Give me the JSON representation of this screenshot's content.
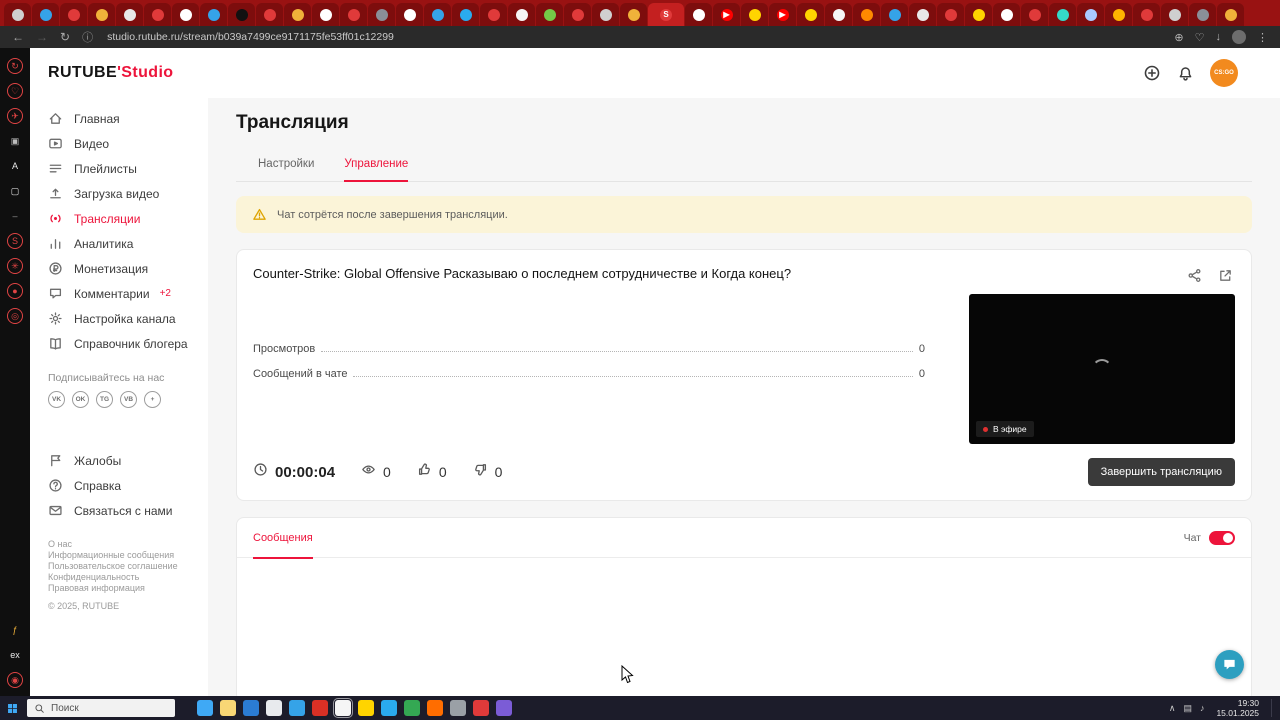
{
  "browser": {
    "url": "studio.rutube.ru/stream/b039a7499ce9171175fe53ff01c12299",
    "nav": {
      "back": "←",
      "forward": "→",
      "reload": "↻",
      "info": "ⓘ",
      "menu": "⋮"
    },
    "actions": [
      {
        "name": "extensions",
        "g": "⊕"
      },
      {
        "name": "favorites",
        "g": "♡"
      },
      {
        "name": "downloads",
        "g": "↓"
      }
    ],
    "tabs": [
      {
        "c": "#cfcfcf"
      },
      {
        "c": "#35a3e8"
      },
      {
        "c": "#e03a3a"
      },
      {
        "c": "#f0b23a"
      },
      {
        "c": "#e8e8e8"
      },
      {
        "c": "#e03a3a"
      },
      {
        "c": "#ffffff"
      },
      {
        "c": "#35a3e8"
      },
      {
        "c": "#111111"
      },
      {
        "c": "#e03a3a"
      },
      {
        "c": "#f0b23a"
      },
      {
        "c": "#ffffff"
      },
      {
        "c": "#e03a3a"
      },
      {
        "c": "#8a8f98"
      },
      {
        "c": "#ffffff"
      },
      {
        "c": "#35a3e8"
      },
      {
        "c": "#2aabee"
      },
      {
        "c": "#e03a3a"
      },
      {
        "c": "#f5f5f5"
      },
      {
        "c": "#74c947"
      },
      {
        "c": "#e03a3a"
      },
      {
        "c": "#d0d0d0"
      },
      {
        "c": "#f0b23a"
      },
      {
        "c": "#e03a3a",
        "g": "S",
        "active": true
      },
      {
        "c": "#ffffff"
      },
      {
        "c": "#ff0000",
        "g": "▶"
      },
      {
        "c": "#ffd400"
      },
      {
        "c": "#ff0000",
        "g": "▶"
      },
      {
        "c": "#ffd400"
      },
      {
        "c": "#f5f5f5"
      },
      {
        "c": "#ff8a00"
      },
      {
        "c": "#35a3e8"
      },
      {
        "c": "#e8e8e8"
      },
      {
        "c": "#e03a3a"
      },
      {
        "c": "#ffd400"
      },
      {
        "c": "#ffffff"
      },
      {
        "c": "#e03a3a"
      },
      {
        "c": "#35d8c8"
      },
      {
        "c": "#a9c9ff"
      },
      {
        "c": "#ffb300"
      },
      {
        "c": "#e03a3a"
      },
      {
        "c": "#cfcfcf"
      },
      {
        "c": "#8a8f98"
      },
      {
        "c": "#f0b23a"
      }
    ]
  },
  "left_rail": {
    "top": [
      {
        "g": "↻",
        "c": "#e04444",
        "b": true
      },
      {
        "g": "♡",
        "c": "#e04444",
        "b": true
      },
      {
        "g": "✈",
        "c": "#e04444",
        "b": true
      },
      {
        "g": "▣",
        "c": "#bdbdbd",
        "b": false
      },
      {
        "g": "A",
        "c": "#e8e8e8",
        "b": false
      },
      {
        "g": "▢",
        "c": "#e8e8e8",
        "b": false
      },
      {
        "g": "–",
        "c": "#9a9a9a",
        "b": false
      },
      {
        "g": "S",
        "c": "#e04444",
        "b": true
      },
      {
        "g": "✳",
        "c": "#e04444",
        "b": true
      },
      {
        "g": "●",
        "c": "#e04444",
        "b": true
      },
      {
        "g": "◎",
        "c": "#e04444",
        "b": true
      }
    ],
    "bottom": [
      {
        "g": "ƒ",
        "c": "#f0b23a",
        "b": false
      },
      {
        "g": "ex",
        "c": "#e8e8e8",
        "b": false
      },
      {
        "g": "◉",
        "c": "#e04444",
        "b": true
      }
    ]
  },
  "header": {
    "logo": {
      "brand": "RUTUBE",
      "mark": "'",
      "suffix": "Studio"
    },
    "avatar_text": "CS:GO"
  },
  "sidebar": {
    "items": [
      {
        "name": "home",
        "icon": "home",
        "label": "Главная"
      },
      {
        "name": "video",
        "icon": "video",
        "label": "Видео"
      },
      {
        "name": "playlists",
        "icon": "playlists",
        "label": "Плейлисты"
      },
      {
        "name": "upload",
        "icon": "upload",
        "label": "Загрузка видео"
      },
      {
        "name": "broadcasts",
        "icon": "broadcast",
        "label": "Трансляции",
        "active": true
      },
      {
        "name": "analytics",
        "icon": "analytics",
        "label": "Аналитика"
      },
      {
        "name": "monetization",
        "icon": "monetization",
        "label": "Монетизация"
      },
      {
        "name": "comments",
        "icon": "comments",
        "label": "Комментарии",
        "badge": "+2"
      },
      {
        "name": "channel-settings",
        "icon": "settings",
        "label": "Настройка канала"
      },
      {
        "name": "blogger-guide",
        "icon": "guide",
        "label": "Справочник блогера"
      }
    ],
    "subscribe_label": "Подписывайтесь на нас",
    "socials": [
      {
        "name": "vk",
        "glyph": "VK"
      },
      {
        "name": "ok",
        "glyph": "OK"
      },
      {
        "name": "telegram",
        "glyph": "TG"
      },
      {
        "name": "viber",
        "glyph": "VB"
      },
      {
        "name": "more",
        "glyph": "+"
      }
    ],
    "secondary": [
      {
        "name": "complaints",
        "icon": "flag",
        "label": "Жалобы"
      },
      {
        "name": "help",
        "icon": "help",
        "label": "Справка"
      },
      {
        "name": "contact-us",
        "icon": "mail",
        "label": "Связаться с нами"
      }
    ],
    "footer_links": [
      "О нас",
      "Информационные сообщения",
      "Пользовательское соглашение",
      "Конфиденциальность",
      "Правовая информация"
    ],
    "copyright": "© 2025, RUTUBE"
  },
  "page": {
    "title": "Трансляция",
    "tabs": [
      {
        "label": "Настройки"
      },
      {
        "label": "Управление"
      }
    ],
    "warning": "Чат сотрётся после завершения трансляции.",
    "stream": {
      "title": "Counter-Strike: Global Offensive Расказываю о последнем сотрудничестве и Когда конец?",
      "stats": [
        {
          "label": "Просмотров",
          "value": "0"
        },
        {
          "label": "Сообщений в чате",
          "value": "0"
        }
      ],
      "live_badge": "В эфире",
      "timer": "00:00:04",
      "viewers": "0",
      "likes": "0",
      "dislikes": "0",
      "end_button": "Завершить трансляцию"
    },
    "messages": {
      "tab": "Сообщения",
      "chat_label": "Чат"
    }
  },
  "taskbar": {
    "search_placeholder": "Поиск",
    "time": "19:30",
    "date": "15.01.2025",
    "apps": [
      {
        "c": "#3fa9f5"
      },
      {
        "c": "#f8d775"
      },
      {
        "c": "#2b7cd3"
      },
      {
        "c": "#e8eaed"
      },
      {
        "c": "#35a3e8"
      },
      {
        "c": "#d93025"
      },
      {
        "c": "#f5f5f5",
        "active": true
      },
      {
        "c": "#ffd400"
      },
      {
        "c": "#2aabee"
      },
      {
        "c": "#34a853"
      },
      {
        "c": "#ff6d00"
      },
      {
        "c": "#9aa0a6"
      },
      {
        "c": "#e03a3a"
      },
      {
        "c": "#7b5cd6"
      }
    ],
    "tray": [
      {
        "g": "∧"
      },
      {
        "g": "▤"
      },
      {
        "g": "♪"
      }
    ]
  },
  "colors": {
    "accent": "#ed143b",
    "tabstrip": "#991212",
    "taskbar": "#1c1c2a",
    "warning_bg": "#fbf4d8",
    "fab": "#2d9fc0"
  }
}
